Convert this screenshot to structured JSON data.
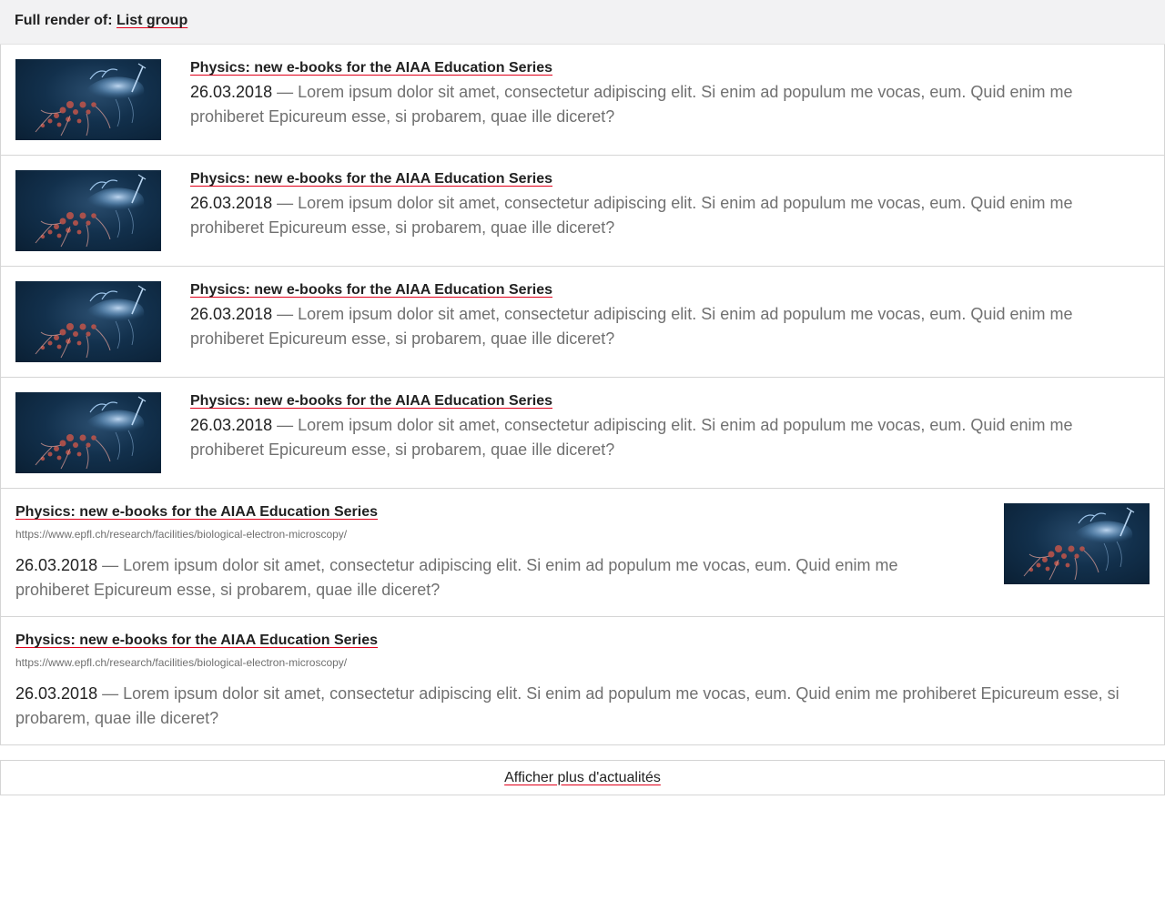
{
  "header": {
    "prefix": "Full render of:",
    "link": "List group"
  },
  "items": [
    {
      "title": "Physics: new e-books for the AIAA Education Series",
      "date": "26.03.2018",
      "excerpt": " — Lorem ipsum dolor sit amet, consectetur adipiscing elit. Si enim ad populum me vocas, eum. Quid enim me prohiberet Epicureum esse, si probarem, quae ille diceret?"
    },
    {
      "title": "Physics: new e-books for the AIAA Education Series",
      "date": "26.03.2018",
      "excerpt": " — Lorem ipsum dolor sit amet, consectetur adipiscing elit. Si enim ad populum me vocas, eum. Quid enim me prohiberet Epicureum esse, si probarem, quae ille diceret?"
    },
    {
      "title": "Physics: new e-books for the AIAA Education Series",
      "date": "26.03.2018",
      "excerpt": " — Lorem ipsum dolor sit amet, consectetur adipiscing elit. Si enim ad populum me vocas, eum. Quid enim me prohiberet Epicureum esse, si probarem, quae ille diceret?"
    },
    {
      "title": "Physics: new e-books for the AIAA Education Series",
      "date": "26.03.2018",
      "excerpt": " — Lorem ipsum dolor sit amet, consectetur adipiscing elit. Si enim ad populum me vocas, eum. Quid enim me prohiberet Epicureum esse, si probarem, quae ille diceret?"
    },
    {
      "title": "Physics: new e-books for the AIAA Education Series",
      "url": "https://www.epfl.ch/research/facilities/biological-electron-microscopy/",
      "date": "26.03.2018",
      "excerpt": " — Lorem ipsum dolor sit amet, consectetur adipiscing elit. Si enim ad populum me vocas, eum. Quid enim me prohiberet Epicureum esse, si probarem, quae ille diceret?"
    },
    {
      "title": "Physics: new e-books for the AIAA Education Series",
      "url": "https://www.epfl.ch/research/facilities/biological-electron-microscopy/",
      "date": "26.03.2018",
      "excerpt": " — Lorem ipsum dolor sit amet, consectetur adipiscing elit. Si enim ad populum me vocas, eum. Quid enim me prohiberet Epicureum esse, si probarem, quae ille diceret?"
    }
  ],
  "more_link": "Afficher plus d'actualités",
  "colors": {
    "accent": "#e2001a",
    "text": "#212121",
    "muted": "#707070",
    "border": "#d5d5d5"
  },
  "icons": {
    "thumbnail": "jellyfish-image"
  }
}
